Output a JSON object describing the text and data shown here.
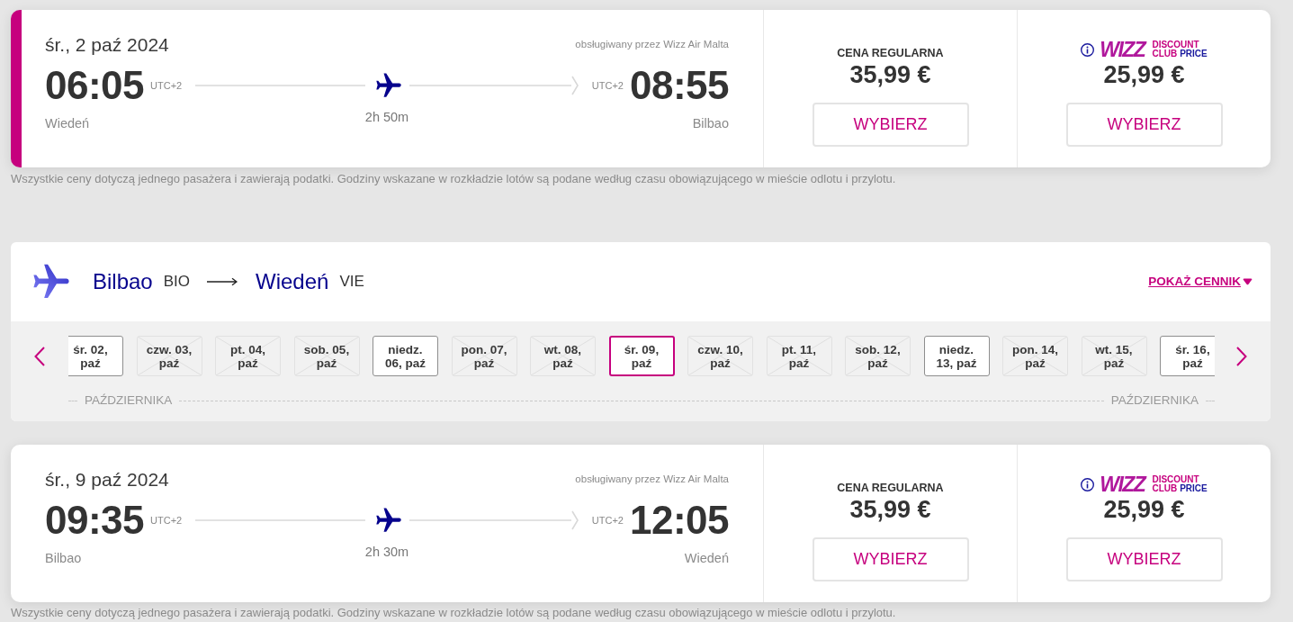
{
  "outbound": {
    "flight": {
      "selected": true,
      "date": "śr., 2 paź 2024",
      "operator": "obsługiwany przez Wizz Air Malta",
      "departure": {
        "time": "06:05",
        "timezone": "UTC+2",
        "city": "Wiedeń"
      },
      "duration": "2h 50m",
      "arrival": {
        "timezone": "UTC+2",
        "time": "08:55",
        "city": "Bilbao"
      },
      "fares": [
        {
          "kind": "regular",
          "label": "CENA REGULARNA",
          "price": "35,99 €",
          "button": "WYBIERZ"
        },
        {
          "kind": "club",
          "logo": {
            "wordmark": "WIZZ",
            "line1": "DISCOUNT",
            "club": "CLUB",
            "price": "PRICE"
          },
          "price": "25,99 €",
          "button": "WYBIERZ"
        }
      ]
    },
    "note": "Wszystkie ceny dotyczą jednego pasażera i zawierają podatki. Godziny wskazane w rozkładzie lotów są podane według czasu obowiązującego w mieście odlotu i przylotu."
  },
  "return": {
    "route": {
      "from": {
        "city": "Bilbao",
        "code": "BIO"
      },
      "to": {
        "city": "Wiedeń",
        "code": "VIE"
      },
      "link": "POKAŻ CENNIK"
    },
    "dates": {
      "tiles": [
        {
          "label": "śr. 02, paź",
          "available": true,
          "selected": false
        },
        {
          "label": "czw. 03, paź",
          "available": false,
          "selected": false
        },
        {
          "label": "pt. 04, paź",
          "available": false,
          "selected": false
        },
        {
          "label": "sob. 05, paź",
          "available": false,
          "selected": false
        },
        {
          "label": "niedz. 06, paź",
          "available": true,
          "selected": false
        },
        {
          "label": "pon. 07, paź",
          "available": false,
          "selected": false
        },
        {
          "label": "wt. 08, paź",
          "available": false,
          "selected": false
        },
        {
          "label": "śr. 09, paź",
          "available": true,
          "selected": true
        },
        {
          "label": "czw. 10, paź",
          "available": false,
          "selected": false
        },
        {
          "label": "pt. 11, paź",
          "available": false,
          "selected": false
        },
        {
          "label": "sob. 12, paź",
          "available": false,
          "selected": false
        },
        {
          "label": "niedz. 13, paź",
          "available": true,
          "selected": false
        },
        {
          "label": "pon. 14, paź",
          "available": false,
          "selected": false
        },
        {
          "label": "wt. 15, paź",
          "available": false,
          "selected": false
        },
        {
          "label": "śr. 16, paź",
          "available": true,
          "selected": false
        }
      ],
      "months": [
        "PAŹDZIERNIKA",
        "PAŹDZIERNIKA"
      ]
    },
    "flight": {
      "selected": false,
      "date": "śr., 9 paź 2024",
      "operator": "obsługiwany przez Wizz Air Malta",
      "departure": {
        "time": "09:35",
        "timezone": "UTC+2",
        "city": "Bilbao"
      },
      "duration": "2h 30m",
      "arrival": {
        "timezone": "UTC+2",
        "time": "12:05",
        "city": "Wiedeń"
      },
      "fares": [
        {
          "kind": "regular",
          "label": "CENA REGULARNA",
          "price": "35,99 €",
          "button": "WYBIERZ"
        },
        {
          "kind": "club",
          "logo": {
            "wordmark": "WIZZ",
            "line1": "DISCOUNT",
            "club": "CLUB",
            "price": "PRICE"
          },
          "price": "25,99 €",
          "button": "WYBIERZ"
        }
      ]
    },
    "note": "Wszystkie ceny dotyczą jednego pasażera i zawierają podatki. Godziny wskazane w rozkładzie lotów są podane według czasu obowiązującego w mieście odlotu i przylotu."
  }
}
